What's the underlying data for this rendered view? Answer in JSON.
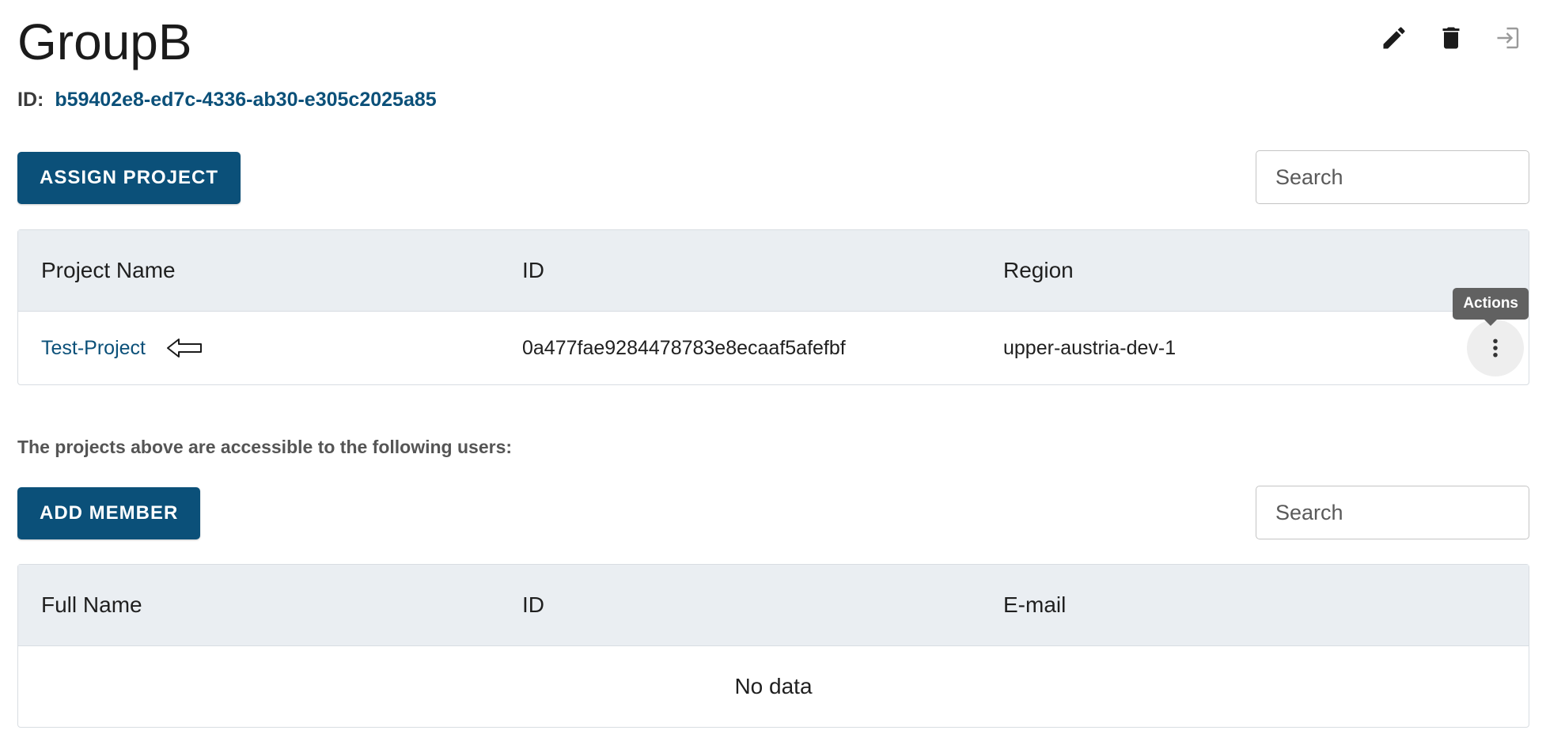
{
  "header": {
    "title": "GroupB",
    "id_label": "ID:",
    "id_value": "b59402e8-ed7c-4336-ab30-e305c2025a85",
    "actions": {
      "edit_icon": "pencil-icon",
      "delete_icon": "trash-icon",
      "leave_icon": "exit-icon"
    }
  },
  "projects": {
    "assign_label": "ASSIGN PROJECT",
    "search_placeholder": "Search",
    "columns": [
      "Project Name",
      "ID",
      "Region"
    ],
    "rows": [
      {
        "name": "Test-Project",
        "id": "0a477fae9284478783e8ecaaf5afefbf",
        "region": "upper-austria-dev-1"
      }
    ],
    "actions_tooltip": "Actions"
  },
  "members": {
    "info_text": "The projects above are accessible to the following users:",
    "add_label": "ADD MEMBER",
    "search_placeholder": "Search",
    "columns": [
      "Full Name",
      "ID",
      "E-mail"
    ],
    "empty_text": "No data"
  },
  "colors": {
    "primary": "#0b5079",
    "table_header_bg": "#eaeef2",
    "tooltip_bg": "#616161"
  }
}
